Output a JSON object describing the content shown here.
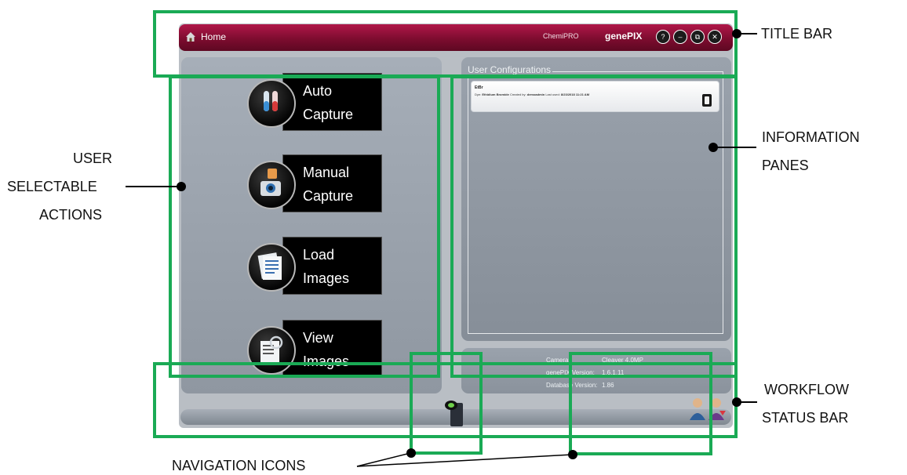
{
  "window": {
    "home_label": "Home",
    "product_label": "ChemiPRO",
    "brand_label": "genePIX",
    "controls": [
      "?",
      "–",
      "⧉",
      "✕"
    ]
  },
  "actions": [
    {
      "line1": "Auto",
      "line2": "Capture",
      "icon": "test-tubes-icon"
    },
    {
      "line1": "Manual",
      "line2": "Capture",
      "icon": "camera-hand-icon"
    },
    {
      "line1": "Load",
      "line2": "Images",
      "icon": "image-stack-icon"
    },
    {
      "line1": "View",
      "line2": "Images",
      "icon": "view-images-icon"
    }
  ],
  "user_config": {
    "legend": "User Configurations",
    "card": {
      "name": "EtBr",
      "dye_label": "Dye:",
      "dye": "Ethidium Bromide",
      "created_label": "Created by:",
      "created_by": "demoadmin",
      "last_used_label": "Last used:",
      "last_used": "8/23/2018 11:21 AM"
    }
  },
  "info": {
    "camera_label": "Camera:",
    "camera_value": "Cleaver 4.0MP",
    "version_label": "genePIX Version:",
    "version_value": "1.6.1.11",
    "db_label": "Database Version:",
    "db_value": "1.86"
  },
  "annotations": {
    "title_bar": "TITLE BAR",
    "user_actions": [
      "USER",
      "SELECTABLE",
      "ACTIONS"
    ],
    "info_panes": [
      "INFORMATION",
      "PANES"
    ],
    "workflow": [
      "WORKFLOW",
      "STATUS BAR"
    ],
    "nav_icons": "NAVIGATION ICONS"
  },
  "colors": {
    "title_bar": "#8a0f37",
    "annotation_green": "#1aaa55",
    "panel_gray": "#9aa2ac"
  }
}
